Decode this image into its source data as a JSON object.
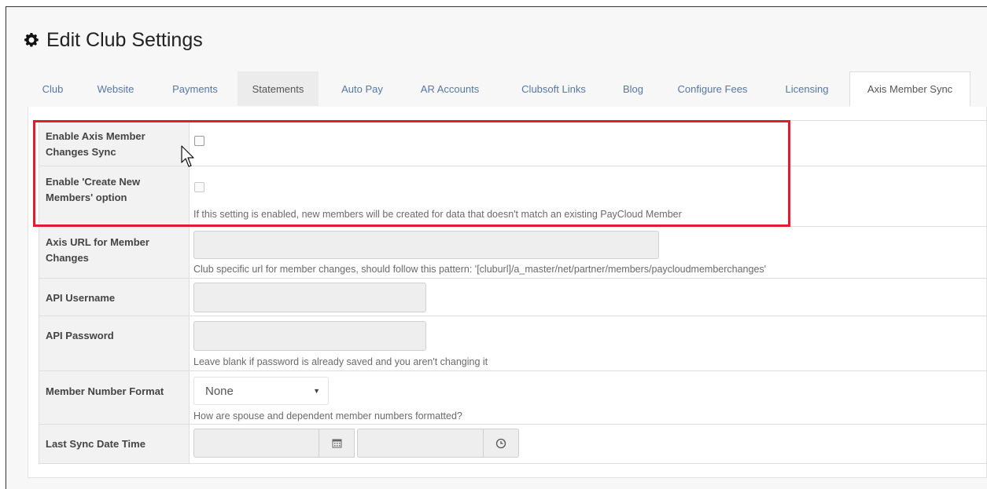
{
  "page": {
    "title": "Edit Club Settings",
    "title_icon": "gear-icon"
  },
  "tabs": [
    {
      "label": "Club"
    },
    {
      "label": "Website"
    },
    {
      "label": "Payments"
    },
    {
      "label": "Statements"
    },
    {
      "label": "Auto Pay"
    },
    {
      "label": "AR Accounts"
    },
    {
      "label": "Clubsoft Links"
    },
    {
      "label": "Blog"
    },
    {
      "label": "Configure Fees"
    },
    {
      "label": "Licensing"
    },
    {
      "label": "Axis Member Sync"
    }
  ],
  "active_tab": "Axis Member Sync",
  "settings": {
    "enable_sync": {
      "label": "Enable Axis Member Changes Sync",
      "checked": false
    },
    "create_new_members": {
      "label": "Enable 'Create New Members' option",
      "checked": false,
      "help": "If this setting is enabled, new members will be created for data that doesn't match an existing PayCloud Member"
    },
    "axis_url": {
      "label": "Axis URL for Member Changes",
      "value": "",
      "help": "Club specific url for member changes, should follow this pattern: '[cluburl]/a_master/net/partner/members/paycloudmemberchanges'"
    },
    "api_username": {
      "label": "API Username",
      "value": ""
    },
    "api_password": {
      "label": "API Password",
      "value": "",
      "help": "Leave blank if password is already saved and you aren't changing it"
    },
    "member_number_format": {
      "label": "Member Number Format",
      "selected": "None",
      "help": "How are spouse and dependent member numbers formatted?"
    },
    "last_sync": {
      "label": "Last Sync Date Time",
      "date_value": "",
      "time_value": "",
      "date_icon": "calendar-icon",
      "time_icon": "clock-icon"
    }
  },
  "colors": {
    "highlight": "#e01e2b",
    "tab_link": "#5577aa",
    "label_bg": "#f2f2f2"
  }
}
